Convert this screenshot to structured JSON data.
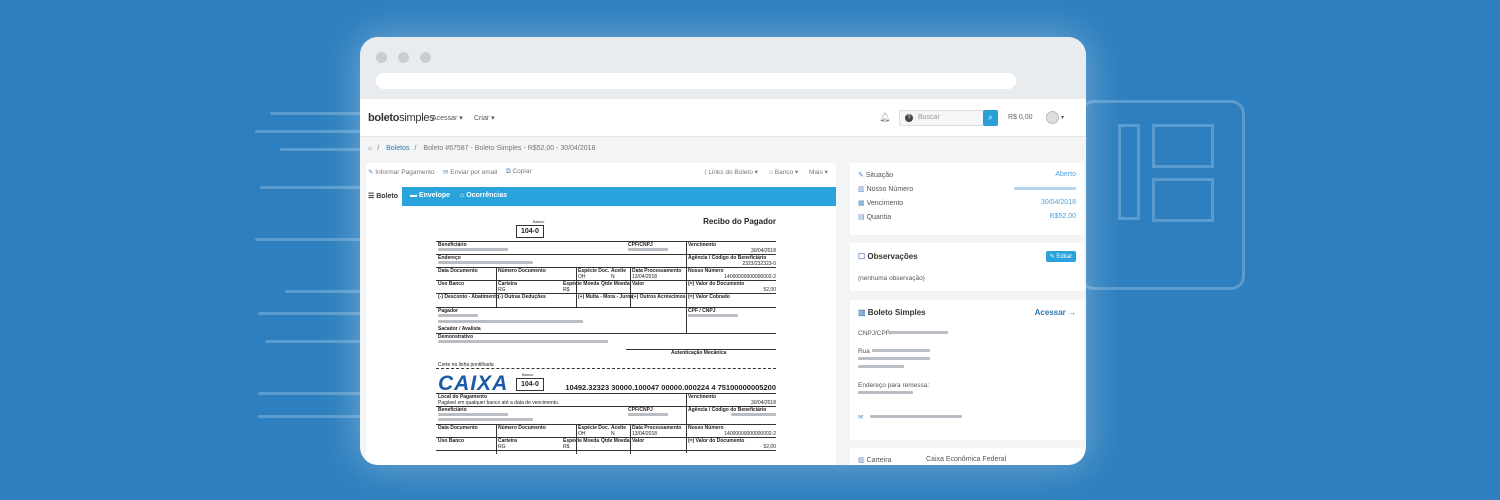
{
  "brand": {
    "name_a": "boleto",
    "name_b": "simples"
  },
  "nav": {
    "acessar": "Acessar",
    "criar": "Criar",
    "search_placeholder": "Buscar",
    "balance": "R$ 0,00"
  },
  "breadcrumb": [
    "Boletos",
    "Boleto #67587 - Boleto Simples - R$52,00 - 30/04/2018"
  ],
  "actions": {
    "informar": "Informar Pagamento",
    "enviar": "Enviar por email",
    "copiar": "Copiar",
    "links": "Links do Boleto",
    "banco": "Banco",
    "mais": "Mais"
  },
  "tabs": {
    "boleto": "Boleto",
    "envelope": "Envelope",
    "ocorrencias": "Ocorrências"
  },
  "doc": {
    "recibo": "Recibo do Pagador",
    "banco_label": "Banco",
    "bank_code": "104-0",
    "beneficiario": "Beneficiário",
    "cpf_cnpj": "CPF/CNPJ",
    "vencimento": "Vencimento",
    "venc_value": "30/04/2018",
    "endereco": "Endereço",
    "agencia": "Agência / Código do Beneficiário",
    "agencia_value": "2323/232323-0",
    "data_documento": "Data Documento",
    "numero_documento": "Número Documento",
    "especie_doc": "Espécie Doc.",
    "aceite": "Aceite",
    "data_processamento": "Data Processamento",
    "nosso_numero": "Nosso Número",
    "especie_doc_v": "OH",
    "aceite_v": "N",
    "data_proc_v": "13/04/2018",
    "nosso_numero_v": "14000000000000002-2",
    "uso_banco": "Uso Banco",
    "carteira": "Carteira",
    "especie_moeda": "Espécie Moeda",
    "qtde_moeda": "Qtde Moeda",
    "valor": "Valor",
    "valor_documento": "(=) Valor do Documento",
    "valor_doc_v": "52,00",
    "carteira_v": "RG",
    "especie_moeda_v": "R$",
    "desconto": "(-) Desconto - Abatimento",
    "outras_deducoes": "(-) Outras Deduções",
    "multa": "(+) Multa - Mora - Juros",
    "outros_acrescimos": "(+) Outros Acréscimos",
    "valor_cobrado": "(=) Valor Cobrado",
    "pagador": "Pagador",
    "cpf_cnpj2": "CPF / CNPJ",
    "sacador": "Sacador / Avalista",
    "demonstrativo": "Demonstrativo",
    "autenticacao": "Autenticação Mecânica",
    "corte": "Corte na linha pontilhada",
    "caixa": "CAIXA",
    "linha_digitavel": "10492.32323 30000.100047 00000.000224 4 75100000005200",
    "local_pagamento": "Local do Pagamento",
    "local_texto": "Pagável em qualquer banco até a data de vencimento."
  },
  "side": {
    "situacao": "Situação",
    "situacao_v": "Aberto",
    "nosso_numero": "Nosso Número",
    "vencimento": "Vencimento",
    "vencimento_v": "30/04/2018",
    "quantia": "Quantia",
    "quantia_v": "R$52,00",
    "observacoes": "Observações",
    "editar": "Editar",
    "sem_obs": "(nenhuma observação)",
    "bs_title": "Boleto Simples",
    "acessar": "Acessar →",
    "cnpj": "CNPJ/CPF:",
    "rua": "Rua",
    "endereco_remessa": "Endereço para remessa:",
    "carteira": "Carteira",
    "carteira_v": "Caixa Econômica Federal"
  },
  "colors": {
    "background": "#2e7fbf",
    "accent": "#29a3db",
    "link": "#4aa3df",
    "caixa": "#1a5aa7"
  }
}
